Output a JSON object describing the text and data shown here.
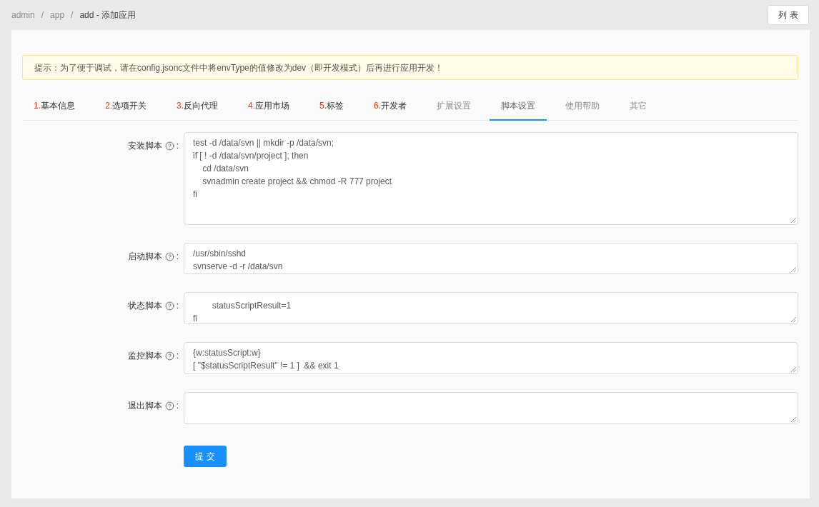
{
  "breadcrumb": [
    {
      "label": "admin",
      "current": false,
      "separator": "/"
    },
    {
      "label": "app",
      "current": false,
      "separator": "/"
    },
    {
      "label": "add - 添加应用",
      "current": true
    }
  ],
  "list_button": "列 表",
  "alert": {
    "text": "提示：为了便于调试，请在config.jsonc文件中将envType的值修改为dev（即开发模式）后再进行应用开发！"
  },
  "tabs": [
    {
      "number": "1.",
      "label": "基本信息",
      "selected": false
    },
    {
      "number": "2.",
      "label": "选项开关",
      "selected": false
    },
    {
      "number": "3.",
      "label": "反向代理",
      "selected": false
    },
    {
      "number": "4.",
      "label": "应用市场",
      "selected": false
    },
    {
      "number": "5.",
      "label": "标签",
      "selected": false
    },
    {
      "number": "6.",
      "label": "开发者",
      "selected": false
    },
    {
      "label": "扩展设置",
      "selected": false
    },
    {
      "label": "脚本设置",
      "selected": true
    },
    {
      "label": "使用帮助",
      "selected": false
    },
    {
      "label": "其它",
      "selected": false
    }
  ],
  "form": {
    "fields": [
      {
        "label": "安装脚本",
        "colon": ":",
        "value": "test -d /data/svn || mkdir -p /data/svn;\nif [ ! -d /data/svn/project ]; then\n    cd /data/svn\n    svnadmin create project && chmod -R 777 project\nfi"
      },
      {
        "label": "启动脚本",
        "colon": ":",
        "value": "/usr/sbin/sshd\nsvnserve -d -r /data/svn"
      },
      {
        "label": "状态脚本",
        "colon": ":",
        "value": "        statusScriptResult=1\nfi"
      },
      {
        "label": "监控脚本",
        "colon": ":",
        "value": "{w:statusScript:w}\n[ \"$statusScriptResult\" != 1 ]  && exit 1"
      },
      {
        "label": "退出脚本",
        "colon": ":"
      }
    ],
    "submit_button": "提 交"
  }
}
